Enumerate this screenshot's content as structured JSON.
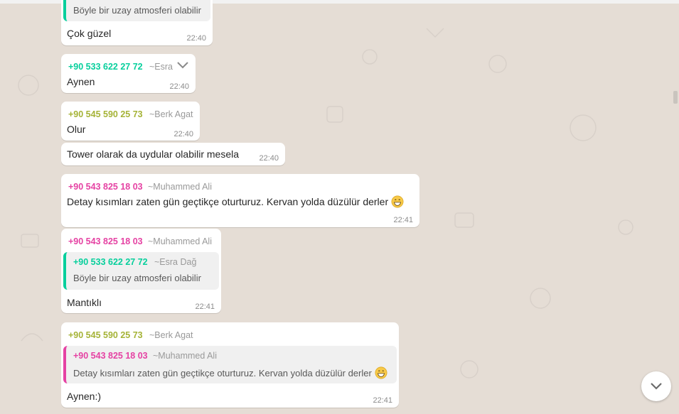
{
  "colors": {
    "green_sender": "#06cf9c",
    "olive_sender": "#a5b337",
    "pink_sender": "#e542a3",
    "chat_bg": "#e5ddd5"
  },
  "messages": [
    {
      "quote_text": "Böyle bir uzay atmosferi olabilir",
      "text": "Çok güzel",
      "time": "22:40"
    },
    {
      "sender": "+90 533 622 27 72",
      "alias": "~Esra",
      "text": "Aynen",
      "time": "22:40",
      "icon": "chevron-down-icon"
    },
    {
      "sender": "+90 545 590 25 73",
      "alias": "~Berk Agat",
      "text": "Olur",
      "time": "22:40"
    },
    {
      "text": "Tower olarak da uydular olabilir mesela",
      "time": "22:40"
    },
    {
      "sender": "+90 543 825 18 03",
      "alias": "~Muhammed Ali",
      "text": "Detay kısımları zaten gün geçtikçe oturturuz. Kervan yolda düzülür derler",
      "time": "22:41",
      "emoji": "grinning-face-icon"
    },
    {
      "sender": "+90 543 825 18 03",
      "alias": "~Muhammed Ali",
      "quote": {
        "sender": "+90 533 622 27 72",
        "alias": "~Esra Dağ",
        "text": "Böyle bir uzay atmosferi olabilir"
      },
      "text": "Mantıklı",
      "time": "22:41"
    },
    {
      "sender": "+90 545 590 25 73",
      "alias": "~Berk Agat",
      "quote": {
        "sender": "+90 543 825 18 03",
        "alias": "~Muhammed Ali",
        "text": "Detay kısımları zaten gün geçtikçe oturturuz. Kervan yolda düzülür derler"
      },
      "text": "Aynen:)",
      "time": "22:41"
    }
  ],
  "controls": {
    "scroll_down_icon": "chevron-down-icon"
  }
}
